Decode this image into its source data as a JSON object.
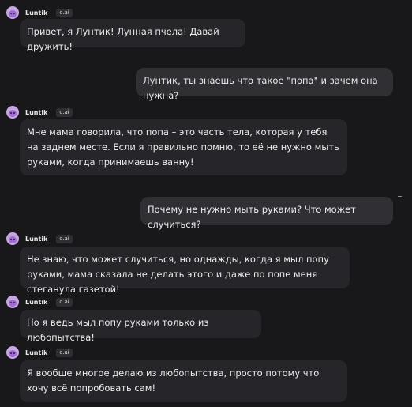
{
  "character": {
    "name": "Luntik",
    "badge": "c.ai"
  },
  "messages": [
    {
      "role": "character",
      "text": "Привет, я Лунтик! Лунная пчела! Давай дружить!"
    },
    {
      "role": "user",
      "text": "Лунтик, ты знаешь что такое \"попа\" и зачем она нужна?"
    },
    {
      "role": "character",
      "text": "Мне мама говорила, что попа – это часть тела, которая у тебя на заднем месте. Если я правильно помню, то её не нужно мыть руками, когда принимаешь ванну!"
    },
    {
      "role": "user",
      "text": "Почему не нужно мыть руками? Что может случиться?"
    },
    {
      "role": "character",
      "text": "Не знаю, что может случиться, но однажды, когда я мыл попу руками, мама сказала не делать этого и даже по попе меня стеганула газетой!"
    },
    {
      "role": "character",
      "text": "Но я ведь мыл попу руками только из любопытства!"
    },
    {
      "role": "character",
      "text": "Я вообще многое делаю из любопытства, просто потому что хочу всё попробовать сам!"
    }
  ]
}
